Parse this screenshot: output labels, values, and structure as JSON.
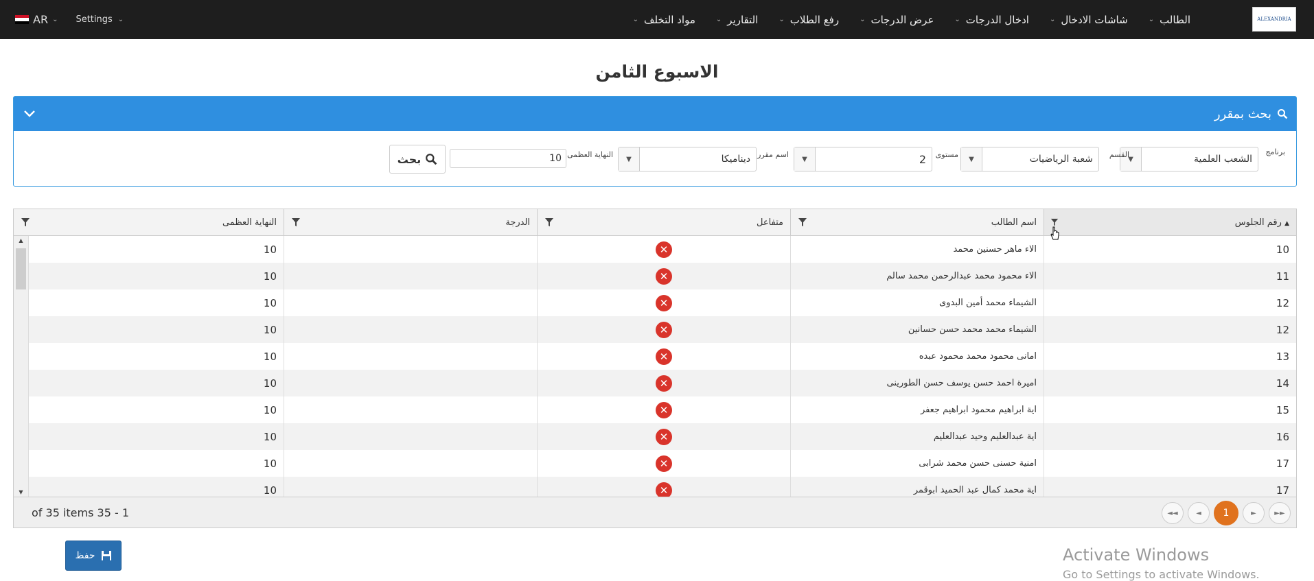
{
  "navbar": {
    "lang_label": "AR",
    "settings_label": "Settings",
    "items": [
      {
        "label": "الطالب"
      },
      {
        "label": "شاشات الادخال"
      },
      {
        "label": "ادخال الدرجات"
      },
      {
        "label": "عرض الدرجات"
      },
      {
        "label": "رفع الطلاب"
      },
      {
        "label": "التقارير"
      },
      {
        "label": "مواد التخلف"
      }
    ],
    "logo_text": "ALEXANDRIA"
  },
  "page_title": "الاسبوع الثامن",
  "search_panel": {
    "title": "بحث بمقرر",
    "fields": {
      "program_label": "برنامج",
      "program_value": "الشعب العلمية",
      "department_label": "القسم",
      "department_value": "شعبة الرياضيات",
      "level_label": "مستوى",
      "level_value": "2",
      "course_label": "اسم مقرر",
      "course_value": "ديناميكا",
      "max_label": "النهاية العظمى",
      "max_value": "10"
    },
    "search_button": "بحث"
  },
  "grid": {
    "columns": {
      "seat_no": "رقم الجلوس",
      "student_name": "اسم الطالب",
      "interactive": "متفاعل",
      "grade": "الدرجة",
      "max_score": "النهاية العظمى"
    },
    "rows": [
      {
        "seat": "10",
        "name": "الاء ماهر حسنين محمد",
        "max": "10"
      },
      {
        "seat": "11",
        "name": "الاء محمود محمد عبدالرحمن محمد سالم",
        "max": "10"
      },
      {
        "seat": "12",
        "name": "الشيماء محمد أمين البدوى",
        "max": "10"
      },
      {
        "seat": "12",
        "name": "الشيماء محمد محمد حسن حسانين",
        "max": "10"
      },
      {
        "seat": "13",
        "name": "امانى محمود محمد محمود عبده",
        "max": "10"
      },
      {
        "seat": "14",
        "name": "اميرة احمد حسن يوسف حسن الطورينى",
        "max": "10"
      },
      {
        "seat": "15",
        "name": "اية ابراهيم محمود ابراهيم جعفر",
        "max": "10"
      },
      {
        "seat": "16",
        "name": "اية عبدالعليم وحيد عبدالعليم",
        "max": "10"
      },
      {
        "seat": "17",
        "name": "امنية حسنى حسن محمد شرابى",
        "max": "10"
      },
      {
        "seat": "17",
        "name": "اية محمد كمال عبد الحميد ابوقمر",
        "max": "10"
      }
    ],
    "footer_info": "of 35 items 35 - 1",
    "current_page": "1"
  },
  "save_button": "حفظ",
  "watermark": {
    "line1": "Activate Windows",
    "line2": "Go to Settings to activate Windows."
  },
  "colors": {
    "navbar_bg": "#1e1e1e",
    "panel_header": "#2f8fe0",
    "not_interactive_mark": "#d9342b",
    "pager_active": "#e0721e",
    "save_button": "#2a6fb0"
  }
}
